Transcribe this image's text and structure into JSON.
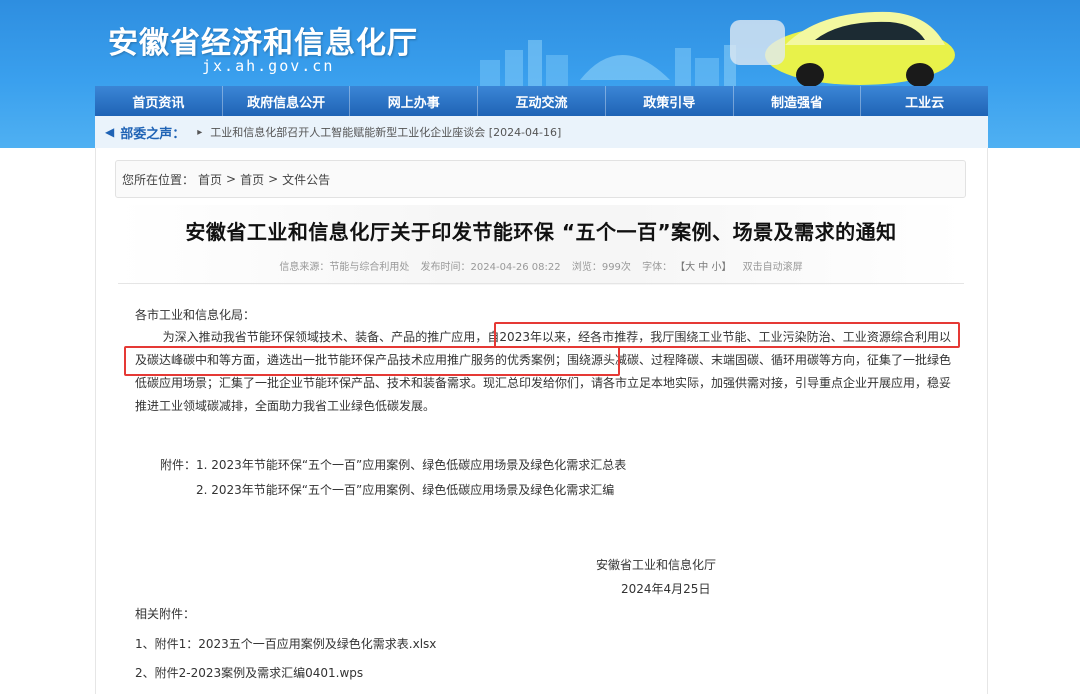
{
  "header": {
    "site_title": "安徽省经济和信息化厅",
    "site_domain": "jx.ah.gov.cn"
  },
  "nav": {
    "items": [
      {
        "label": "首页资讯"
      },
      {
        "label": "政府信息公开"
      },
      {
        "label": "网上办事"
      },
      {
        "label": "互动交流"
      },
      {
        "label": "政策引导"
      },
      {
        "label": "制造强省"
      },
      {
        "label": "工业云"
      }
    ]
  },
  "notice": {
    "label": "部委之声：",
    "text": "工业和信息化部召开人工智能赋能新型工业化企业座谈会 [2024-04-16]"
  },
  "breadcrumb": {
    "prefix": "您所在位置：",
    "item1": "首页",
    "sep1": ">",
    "item2": "首页",
    "sep2": ">",
    "item3": "文件公告"
  },
  "article": {
    "title": "安徽省工业和信息化厅关于印发节能环保 “五个一百”案例、场景及需求的通知",
    "meta": {
      "source": "信息来源：节能与综合利用处",
      "published": "发布时间：2024-04-26 08:22",
      "views": "浏览：999次",
      "font_label": "字体：",
      "font_sizes": "【大 中 小】",
      "auto_scroll": "双击自动滚屏"
    },
    "salutation": "各市工业和信息化局：",
    "paragraph": "为深入推动我省节能环保领域技术、装备、产品的推广应用，自2023年以来，经各市推荐，我厅围绕工业节能、工业污染防治、工业资源综合利用以及碳达峰碳中和等方面，遴选出一批节能环保产品技术应用推广服务的优秀案例；围绕源头减碳、过程降碳、末端固碳、循环用碳等方向，征集了一批绿色低碳应用场景；汇集了一批企业节能环保产品、技术和装备需求。现汇总印发给你们，请各市立足本地实际，加强供需对接，引导重点企业开展应用，稳妥推进工业领域碳减排，全面助力我省工业绿色低碳发展。",
    "attachments_label": "附件：",
    "attachment1": "1. 2023年节能环保“五个一百”应用案例、绿色低碳应用场景及绿色化需求汇总表",
    "attachment2": "2. 2023年节能环保“五个一百”应用案例、绿色低碳应用场景及绿色化需求汇编",
    "sign_org": "安徽省工业和信息化厅",
    "sign_date": "2024年4月25日",
    "related_label": "相关附件：",
    "related1": "1、附件1：2023五个一百应用案例及绿色化需求表.xlsx",
    "related2": "2、附件2-2023案例及需求汇编0401.wps"
  },
  "colors": {
    "nav_bg": "#1f63b5",
    "banner_bg": "#3aa0ee",
    "highlight_border": "#e53935"
  }
}
